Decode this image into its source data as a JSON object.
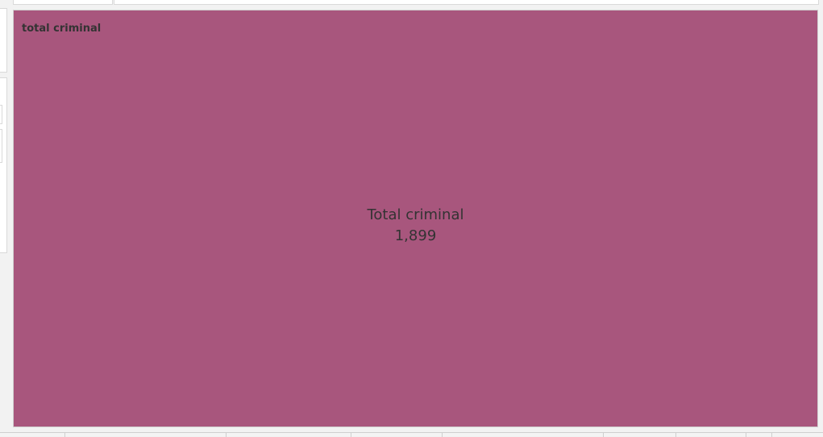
{
  "chart_data": {
    "type": "treemap",
    "title": "total criminal",
    "categories": [
      "Total criminal"
    ],
    "values": [
      1899
    ],
    "value_labels": [
      "1,899"
    ],
    "colors": {
      "fill": "#a8567d",
      "text": "#333333"
    }
  }
}
